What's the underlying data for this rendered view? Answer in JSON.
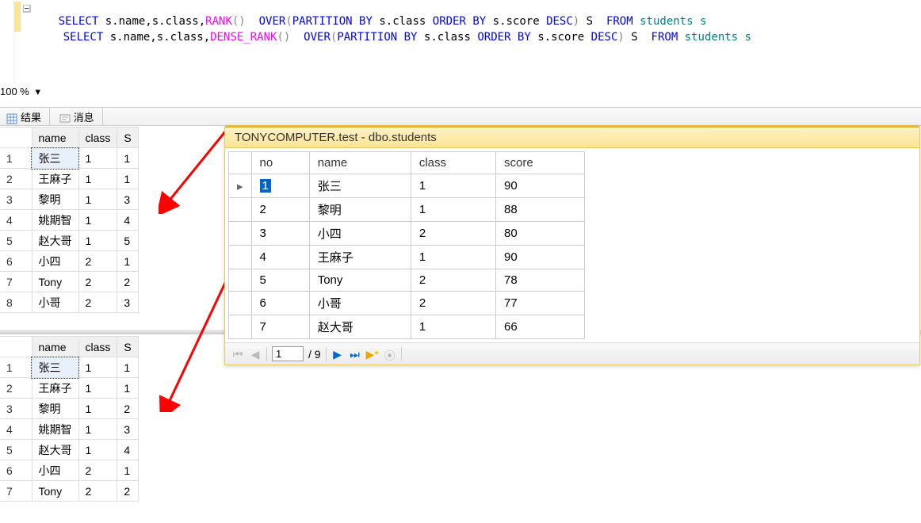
{
  "sql": {
    "line1": {
      "sel": "SELECT",
      "cols": " s.name,s.class,",
      "fn": "RANK",
      "paren": "()",
      "over_kw": "  OVER",
      "over_open": "(",
      "part": "PARTITION",
      "by1": " BY",
      "partcol": " s.class ",
      "ord": "ORDER",
      "by2": " BY",
      "ordcol": " s.score ",
      "desc": "DESC",
      "over_close": ")",
      "alias": " S  ",
      "from": "FROM",
      "tbl": " students s"
    },
    "line2": {
      "sel": "SELECT",
      "cols": " s.name,s.class,",
      "fn": "DENSE_RANK",
      "paren": "()",
      "over_kw": "  OVER",
      "over_open": "(",
      "part": "PARTITION",
      "by1": " BY",
      "partcol": " s.class ",
      "ord": "ORDER",
      "by2": " BY",
      "ordcol": " s.score ",
      "desc": "DESC",
      "over_close": ")",
      "alias": " S  ",
      "from": "FROM",
      "tbl": " students s"
    }
  },
  "zoom": {
    "value": "100 %"
  },
  "tabs": {
    "results": "结果",
    "messages": "消息"
  },
  "grid1": {
    "headers": {
      "name": "name",
      "class": "class",
      "s": "S"
    },
    "rows": [
      {
        "n": "1",
        "name": "张三",
        "class": "1",
        "s": "1"
      },
      {
        "n": "2",
        "name": "王麻子",
        "class": "1",
        "s": "1"
      },
      {
        "n": "3",
        "name": "黎明",
        "class": "1",
        "s": "3"
      },
      {
        "n": "4",
        "name": "姚期智",
        "class": "1",
        "s": "4"
      },
      {
        "n": "5",
        "name": "赵大哥",
        "class": "1",
        "s": "5"
      },
      {
        "n": "6",
        "name": "小四",
        "class": "2",
        "s": "1"
      },
      {
        "n": "7",
        "name": "Tony",
        "class": "2",
        "s": "2"
      },
      {
        "n": "8",
        "name": "小哥",
        "class": "2",
        "s": "3"
      }
    ]
  },
  "grid2": {
    "headers": {
      "name": "name",
      "class": "class",
      "s": "S"
    },
    "rows": [
      {
        "n": "1",
        "name": "张三",
        "class": "1",
        "s": "1"
      },
      {
        "n": "2",
        "name": "王麻子",
        "class": "1",
        "s": "1"
      },
      {
        "n": "3",
        "name": "黎明",
        "class": "1",
        "s": "2"
      },
      {
        "n": "4",
        "name": "姚期智",
        "class": "1",
        "s": "3"
      },
      {
        "n": "5",
        "name": "赵大哥",
        "class": "1",
        "s": "4"
      },
      {
        "n": "6",
        "name": "小四",
        "class": "2",
        "s": "1"
      },
      {
        "n": "7",
        "name": "Tony",
        "class": "2",
        "s": "2"
      }
    ]
  },
  "preview": {
    "title": "TONYCOMPUTER.test - dbo.students",
    "headers": {
      "no": "no",
      "name": "name",
      "class": "class",
      "score": "score"
    },
    "rows": [
      {
        "no": "1",
        "name": "张三",
        "class": "1",
        "score": "90"
      },
      {
        "no": "2",
        "name": "黎明",
        "class": "1",
        "score": "88"
      },
      {
        "no": "3",
        "name": "小四",
        "class": "2",
        "score": "80"
      },
      {
        "no": "4",
        "name": "王麻子",
        "class": "1",
        "score": "90"
      },
      {
        "no": "5",
        "name": "Tony",
        "class": "2",
        "score": "78"
      },
      {
        "no": "6",
        "name": "小哥",
        "class": "2",
        "score": "77"
      },
      {
        "no": "7",
        "name": "赵大哥",
        "class": "1",
        "score": "66"
      }
    ],
    "nav": {
      "current": "1",
      "total": "/ 9"
    }
  }
}
